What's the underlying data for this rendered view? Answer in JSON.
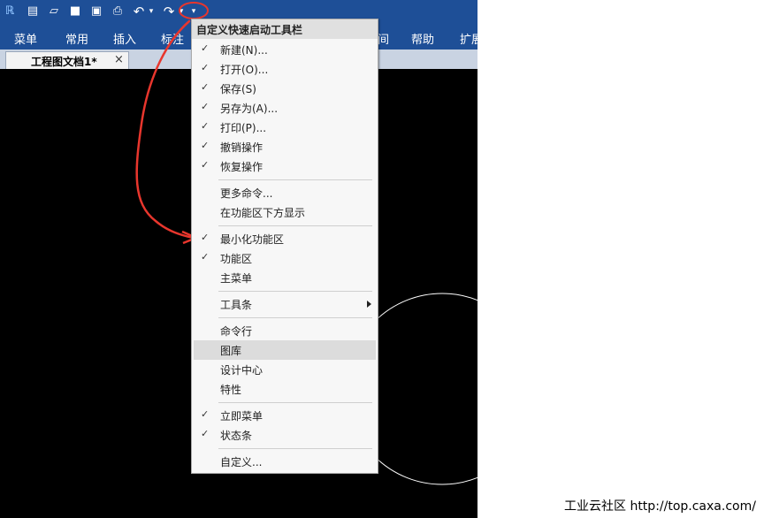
{
  "window": {
    "quick_access": {
      "icons": [
        "app-logo-icon",
        "new-file-icon",
        "open-folder-icon",
        "save-icon",
        "save-as-icon",
        "print-icon",
        "undo-icon",
        "undo-dropdown-icon",
        "redo-icon",
        "redo-dropdown-icon",
        "customize-dropdown-icon"
      ],
      "glyphs": {
        "logo": "ℝ",
        "new": "▤",
        "open": "▱",
        "save": "■",
        "saveas": "▣",
        "print": "⎙",
        "undo": "↶",
        "redo": "↷",
        "small_arrow": "▾"
      }
    },
    "ribbon_tabs": [
      "菜单",
      "常用",
      "插入",
      "标注",
      "间",
      "帮助",
      "扩展"
    ],
    "document_tab": {
      "title": "工程图文档1*",
      "close": "×"
    }
  },
  "menu": {
    "title": "自定义快速启动工具栏",
    "items": [
      {
        "label": "新建(N)...",
        "checked": true
      },
      {
        "label": "打开(O)...",
        "checked": true
      },
      {
        "label": "保存(S)",
        "checked": true
      },
      {
        "label": "另存为(A)...",
        "checked": true
      },
      {
        "label": "打印(P)...",
        "checked": true
      },
      {
        "label": "撤销操作",
        "checked": true
      },
      {
        "label": "恢复操作",
        "checked": true
      },
      {
        "label": "更多命令...",
        "checked": false
      },
      {
        "label": "在功能区下方显示",
        "checked": false
      },
      {
        "label": "最小化功能区",
        "checked": true
      },
      {
        "label": "功能区",
        "checked": true
      },
      {
        "label": "主菜单",
        "checked": false
      },
      {
        "label": "工具条",
        "checked": false,
        "submenu": true
      },
      {
        "label": "命令行",
        "checked": false
      },
      {
        "label": "图库",
        "checked": false,
        "highlighted": true
      },
      {
        "label": "设计中心",
        "checked": false
      },
      {
        "label": "特性",
        "checked": false
      },
      {
        "label": "立即菜单",
        "checked": true
      },
      {
        "label": "状态条",
        "checked": true
      },
      {
        "label": "自定义...",
        "checked": false
      }
    ],
    "check_glyph": "✓"
  },
  "annotation": {
    "color": "#e8362d"
  },
  "watermark": "工业云社区 http://top.caxa.com/"
}
